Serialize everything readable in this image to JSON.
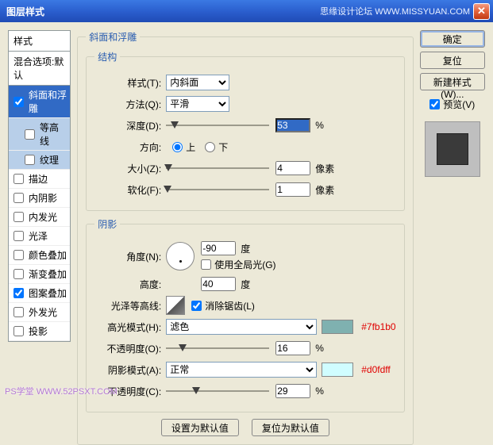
{
  "title": "图层样式",
  "credit": "思缘设计论坛  WWW.MISSYUAN.COM",
  "sidebar": {
    "header": "样式",
    "blend": "混合选项:默认",
    "items": [
      {
        "label": "斜面和浮雕",
        "checked": true,
        "selected": true
      },
      {
        "label": "等高线",
        "checked": false,
        "indent": true,
        "sub": true
      },
      {
        "label": "纹理",
        "checked": false,
        "indent": true,
        "sub": true
      },
      {
        "label": "描边",
        "checked": false
      },
      {
        "label": "内阴影",
        "checked": false
      },
      {
        "label": "内发光",
        "checked": false
      },
      {
        "label": "光泽",
        "checked": false
      },
      {
        "label": "颜色叠加",
        "checked": false
      },
      {
        "label": "渐变叠加",
        "checked": false
      },
      {
        "label": "图案叠加",
        "checked": true
      },
      {
        "label": "外发光",
        "checked": false
      },
      {
        "label": "投影",
        "checked": false
      }
    ]
  },
  "main": {
    "group_title": "斜面和浮雕",
    "structure": {
      "legend": "结构",
      "style_label": "样式(T):",
      "style_value": "内斜面",
      "technique_label": "方法(Q):",
      "technique_value": "平滑",
      "depth_label": "深度(D):",
      "depth_value": "53",
      "depth_unit": "%",
      "direction_label": "方向:",
      "dir_up": "上",
      "dir_down": "下",
      "size_label": "大小(Z):",
      "size_value": "4",
      "size_unit": "像素",
      "soften_label": "软化(F):",
      "soften_value": "1",
      "soften_unit": "像素"
    },
    "shading": {
      "legend": "阴影",
      "angle_label": "角度(N):",
      "angle_value": "-90",
      "angle_unit": "度",
      "global_label": "使用全局光(G)",
      "altitude_label": "高度:",
      "altitude_value": "40",
      "altitude_unit": "度",
      "gloss_label": "光泽等高线:",
      "antialias_label": "消除锯齿(L)",
      "hmode_label": "高光模式(H):",
      "hmode_value": "滤色",
      "hcolor": "#7fb1b0",
      "hopacity_label": "不透明度(O):",
      "hopacity_value": "16",
      "hopacity_unit": "%",
      "smode_label": "阴影模式(A):",
      "smode_value": "正常",
      "scolor": "#d0fdff",
      "sopacity_label": "不透明度(C):",
      "sopacity_value": "29",
      "sopacity_unit": "%"
    },
    "reset_default": "设置为默认值",
    "restore_default": "复位为默认值"
  },
  "right": {
    "ok": "确定",
    "cancel": "复位",
    "newstyle": "新建样式(W)...",
    "preview": "预览(V)"
  },
  "watermark_left": "PS学堂  WWW.52PSXT.COM"
}
